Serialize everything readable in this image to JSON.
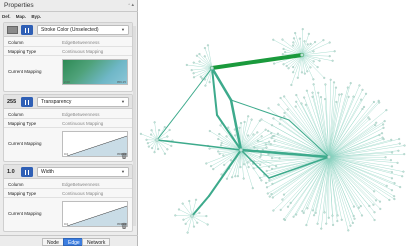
{
  "panel": {
    "title": "Properties",
    "subhead": [
      "Def.",
      "Map.",
      "Byp."
    ],
    "sections": [
      {
        "value": "",
        "property": "Stroke Color (Unselected)",
        "column_label": "Column",
        "column_value": "EdgeBetweenness",
        "type_label": "Mapping Type",
        "type_value": "Continuous Mapping",
        "current_label": "Current Mapping",
        "low": "2.00",
        "high": "959.25"
      },
      {
        "value": "255",
        "property": "Transparency",
        "column_label": "Column",
        "column_value": "EdgeBetweenness",
        "type_label": "Mapping Type",
        "type_value": "Continuous Mapping",
        "current_label": "Current Mapping",
        "low": "0.0",
        "high": "959.25"
      },
      {
        "value": "1.0",
        "property": "Width",
        "column_label": "Column",
        "column_value": "EdgeBetweenness",
        "type_label": "Mapping Type",
        "type_value": "Continuous Mapping",
        "current_label": "Current Mapping",
        "low": "0.0",
        "high": "959.25"
      }
    ],
    "tabs": [
      "Node",
      "Edge",
      "Network"
    ],
    "active_tab": "Edge"
  },
  "colors": {
    "accent": "#2f5fb5",
    "edge_light": "#86d0bd",
    "edge_mid": "#3daa8c",
    "edge_dark": "#1a9a3c"
  }
}
